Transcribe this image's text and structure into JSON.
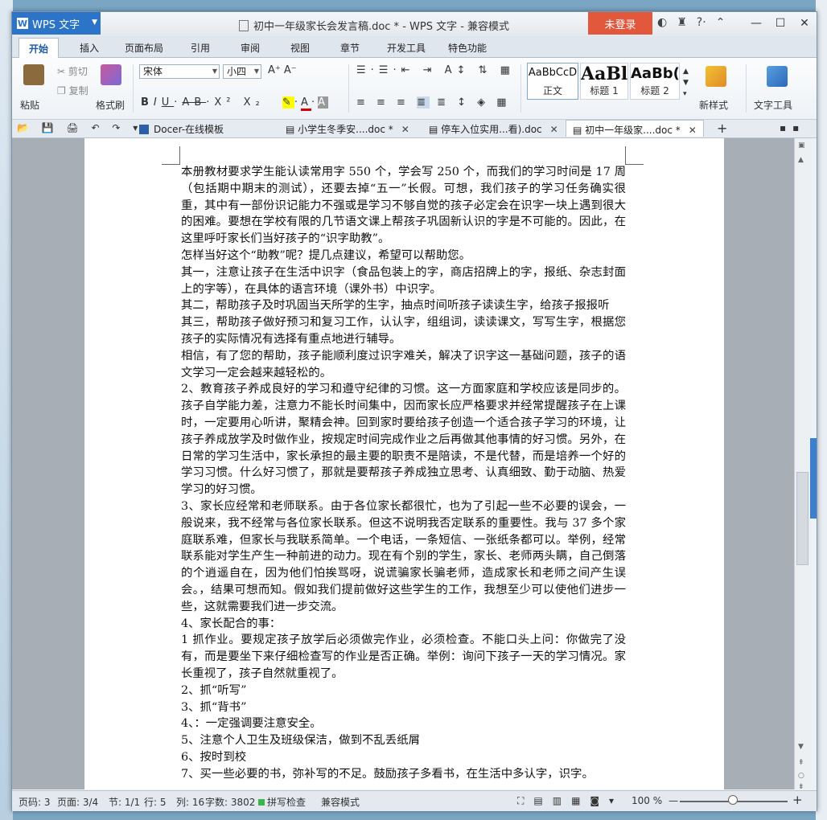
{
  "window": {
    "app_name": "WPS 文字",
    "doc_title": "初中一年级家长会发言稿.doc * - WPS 文字 - 兼容模式",
    "login_label": "未登录"
  },
  "ribbon_tabs": [
    "开始",
    "插入",
    "页面布局",
    "引用",
    "审阅",
    "视图",
    "章节",
    "开发工具",
    "特色功能"
  ],
  "ribbon": {
    "paste": "粘贴",
    "cut": "剪切",
    "copy": "复制",
    "format_painter": "格式刷",
    "font_name": "宋体",
    "font_size": "小四",
    "styles": [
      {
        "preview": "AaBbCcD",
        "label": "正文"
      },
      {
        "preview": "AaBl",
        "label": "标题 1"
      },
      {
        "preview": "AaBb(",
        "label": "标题 2"
      }
    ],
    "new_style": "新样式",
    "text_tools": "文字工具"
  },
  "doc_tabs": [
    {
      "label": "Docer-在线模板"
    },
    {
      "label": "小学生冬季安....doc *"
    },
    {
      "label": "停车入位实用...看).doc"
    },
    {
      "label": "初中一年级家....doc *"
    }
  ],
  "document": {
    "paragraphs": [
      "本册教材要求学生能认读常用字 550 个，学会写 250 个，而我们的学习时间是 17 周（包括期中期末的测试），还要去掉“五一”长假。可想，我们孩子的学习任务确实很重，其中有一部份识记能力不强或是学习不够自觉的孩子必定会在识字一块上遇到很大的困难。要想在学校有限的几节语文课上帮孩子巩固新认识的字是不可能的。因此，在这里呼吁家长们当好孩子的“识字助教”。",
      "怎样当好这个“助教”呢？提几点建议，希望可以帮助您。",
      "其一，注意让孩子在生活中识字（食品包装上的字，商店招牌上的字，报纸、杂志封面上的字等），在具体的语言环境（课外书）中识字。",
      "其二，帮助孩子及时巩固当天所学的生字，抽点时间听孩子读读生字，给孩子报报听",
      "其三，帮助孩子做好预习和复习工作，认认字，组组词，读读课文，写写生字，根据您孩子的实际情况有选择有重点地进行辅导。",
      "相信，有了您的帮助，孩子能顺利度过识字难关，解决了识字这一基础问题，孩子的语文学习一定会越来越轻松的。",
      "2、教育孩子养成良好的学习和遵守纪律的习惯。这一方面家庭和学校应该是同步的。孩子自学能力差，注意力不能长时间集中，因而家长应严格要求并经常提醒孩子在上课时，一定要用心听讲，聚精会神。回到家时要给孩子创造一个适合孩子学习的环境，让孩子养成放学及时做作业，按规定时间完成作业之后再做其他事情的好习惯。另外，在日常的学习生活中，家长承担的最主要的职责不是陪读，不是代替，而是培养一个好的学习习惯。什么好习惯了，那就是要帮孩子养成独立思考、认真细致、勤于动脑、热爱学习的好习惯。",
      "3、家长应经常和老师联系。由于各位家长都很忙，也为了引起一些不必要的误会，一般说来，我不经常与各位家长联系。但这不说明我否定联系的重要性。我与 37 多个家庭联系难，但家长与我联系简单。一个电话，一条短信、一张纸条都可以。举例，经常联系能对学生产生一种前进的动力。现在有个别的学生，家长、老师两头瞒，自己倒落的个逍遥自在，因为他们怕挨骂呀，说谎骗家长骗老师，造成家长和老师之间产生误会。，结果可想而知。假如我们提前做好这些学生的工作，我想至少可以使他们进步一些，这就需要我们进一步交流。",
      "4、家长配合的事：",
      "1 抓作业。要规定孩子放学后必须做完作业，必须检查。不能口头上问：你做完了没有，而是要坐下来仔细检查写的作业是否正确。举例：询问下孩子一天的学习情况。家长重视了，孩子自然就重视了。",
      "2、抓“听写”",
      "3、抓“背书”",
      "4、：一定强调要注意安全。",
      "5、注意个人卫生及班级保洁，做到不乱丢纸屑",
      "6、按时到校",
      "7、买一些必要的书，弥补写的不足。鼓励孩子多看书，在生活中多认字，识字。"
    ]
  },
  "status": {
    "page_num": "页码: 3",
    "pages": "页面: 3/4",
    "section": "节: 1/1",
    "row": "行: 5",
    "col": "列: 16",
    "words": "字数: 3802",
    "spell": "拼写检查",
    "mode": "兼容模式",
    "zoom": "100 %"
  },
  "colors": {
    "accent": "#2b74c8",
    "login": "#e2583d"
  }
}
